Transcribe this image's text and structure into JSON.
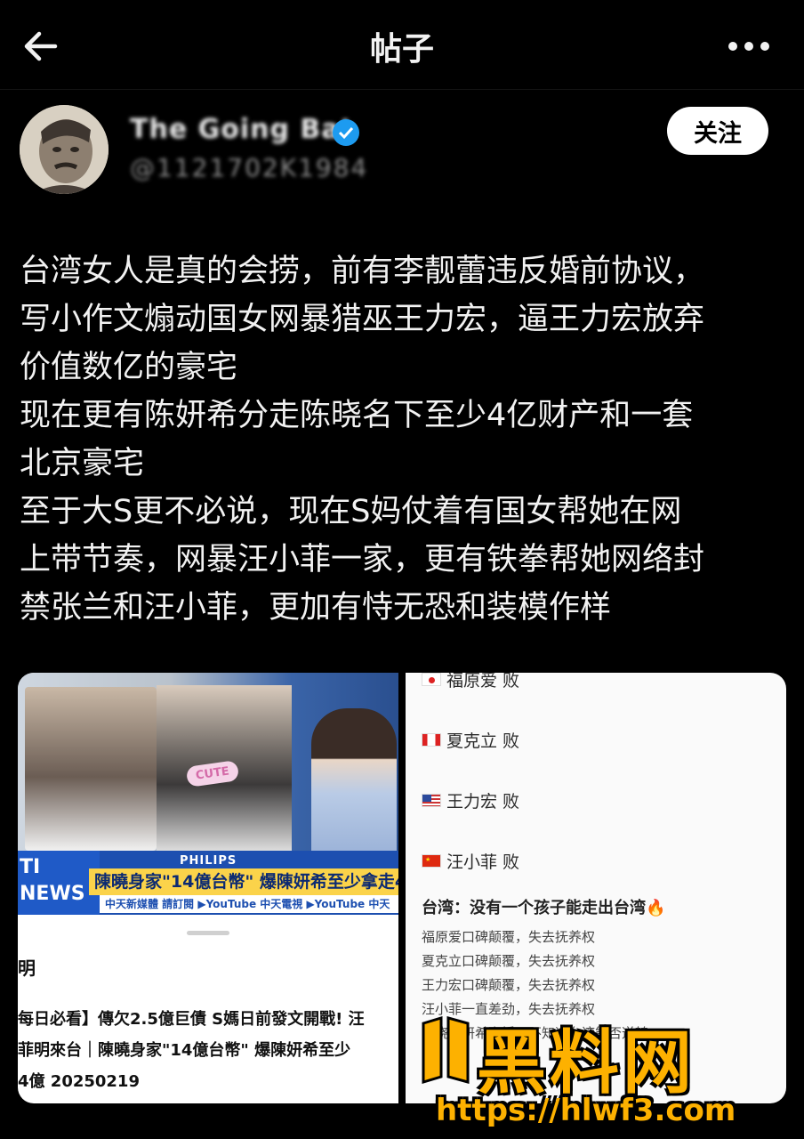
{
  "header": {
    "title": "帖子"
  },
  "author": {
    "name": "The Going Bat",
    "handle": "@1121702K1984"
  },
  "follow_label": "关注",
  "post_lines": [
    "台湾女人是真的会捞，前有李靓蕾违反婚前协议，",
    "写小作文煽动国女网暴猎巫王力宏，逼王力宏放弃",
    "价值数亿的豪宅",
    "现在更有陈妍希分走陈晓名下至少4亿财产和一套",
    "北京豪宅",
    "至于大S更不必说，现在S妈仗着有国女帮她在网",
    "上带节奏，网暴汪小菲一家，更有铁拳帮她网络封",
    "禁张兰和汪小菲，更加有恃无恐和装模作样"
  ],
  "image1": {
    "brand": "TI\nNEWS",
    "sponsor": "PHILIPS",
    "cute": "CUTE",
    "headline": "陳曉身家\"14億台幣\" 爆陳妍希至少拿走4",
    "subbar": "中天新媒體 請訂閱 ▶YouTube 中天電視 ▶YouTube 中天",
    "section": "明",
    "video_title": [
      "每日必看】傳欠2.5億巨債 S媽日前發文開戰! 汪",
      "菲明來台｜陳曉身家\"14億台幣\" 爆陳妍希至少",
      "4億 20250219"
    ]
  },
  "image2": {
    "rows": [
      {
        "flag": "jp",
        "text": "福原爱 败"
      },
      {
        "flag": "ca",
        "text": "夏克立 败"
      },
      {
        "flag": "us",
        "text": "王力宏 败"
      },
      {
        "flag": "cn",
        "text": "汪小菲 败"
      }
    ],
    "title": "台湾：没有一个孩子能走出台湾🔥",
    "lines": [
      "福原爱口碑颠覆，失去抚养权",
      "夏克立口碑颠覆，失去抚养权",
      "王力宏口碑颠覆，失去抚养权",
      "汪小菲一直差劲，失去抚养权",
      "陈晓陈妍希离婚，不知道台湾能否逆转"
    ]
  },
  "watermark": {
    "main": "黑料网",
    "url": "https://hlwf3.com"
  }
}
